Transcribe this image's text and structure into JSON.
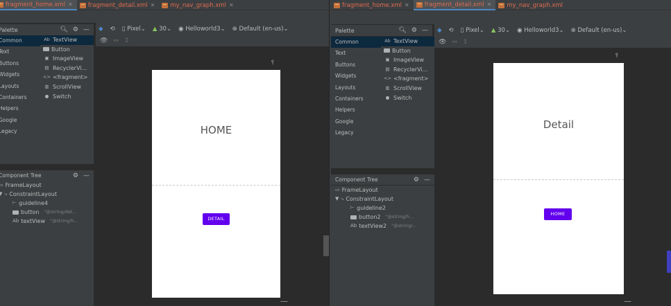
{
  "left": {
    "tabs": [
      {
        "label": "fragment_home.xml",
        "active": true
      },
      {
        "label": "fragment_detail.xml",
        "active": false
      },
      {
        "label": "my_nav_graph.xml",
        "active": false
      }
    ],
    "toolbar": {
      "device": "Pixel",
      "api": "30",
      "theme": "Helloworld3",
      "locale": "Default (en-us)"
    },
    "palette_title": "Palette",
    "categories": [
      "Common",
      "Text",
      "Buttons",
      "Widgets",
      "Layouts",
      "Containers",
      "Helpers",
      "Google",
      "Legacy"
    ],
    "items": [
      {
        "icon": "Ab",
        "label": "TextView"
      },
      {
        "icon": "",
        "label": "Button"
      },
      {
        "icon": "▣",
        "label": "ImageView"
      },
      {
        "icon": "▤",
        "label": "RecyclerVi..."
      },
      {
        "icon": "<>",
        "label": "<fragment>"
      },
      {
        "icon": "▥",
        "label": "ScrollView"
      },
      {
        "icon": "●",
        "label": "Switch"
      }
    ],
    "component_tree_title": "Component Tree",
    "tree": [
      {
        "icon": "▭",
        "label": "FrameLayout",
        "attr": ""
      },
      {
        "icon": "⤷",
        "label": "ConstraintLayout",
        "attr": ""
      },
      {
        "icon": "⊢",
        "label": "guideline4",
        "attr": ""
      },
      {
        "icon": "",
        "label": "button",
        "attr": "\"@string/det..."
      },
      {
        "icon": "Ab",
        "label": "textView",
        "attr": "\"@string/h..."
      }
    ],
    "design_title": "HOME",
    "design_button": "DETAIL"
  },
  "right": {
    "tabs": [
      {
        "label": "fragment_home.xml",
        "active": false
      },
      {
        "label": "fragment_detail.xml",
        "active": true
      },
      {
        "label": "my_nav_graph.xml",
        "active": false
      }
    ],
    "toolbar": {
      "device": "Pixel",
      "api": "30",
      "theme": "Helloworld3",
      "locale": "Default (en-us)"
    },
    "palette_title": "Palette",
    "categories": [
      "Common",
      "Text",
      "Buttons",
      "Widgets",
      "Layouts",
      "Containers",
      "Helpers",
      "Google",
      "Legacy"
    ],
    "items": [
      {
        "icon": "Ab",
        "label": "TextView"
      },
      {
        "icon": "",
        "label": "Button"
      },
      {
        "icon": "▣",
        "label": "ImageView"
      },
      {
        "icon": "▤",
        "label": "RecyclerVi..."
      },
      {
        "icon": "<>",
        "label": "<fragment>"
      },
      {
        "icon": "▥",
        "label": "ScrollView"
      },
      {
        "icon": "●",
        "label": "Switch"
      }
    ],
    "component_tree_title": "Component Tree",
    "tree": [
      {
        "icon": "▭",
        "label": "FrameLayout",
        "attr": ""
      },
      {
        "icon": "⤷",
        "label": "ConstraintLayout",
        "attr": ""
      },
      {
        "icon": "⊢",
        "label": "guideline2",
        "attr": ""
      },
      {
        "icon": "",
        "label": "button2",
        "attr": "\"@string/h..."
      },
      {
        "icon": "Ab",
        "label": "textView2",
        "attr": "\"@string/..."
      }
    ],
    "design_title": "Detail",
    "design_button": "HOME"
  },
  "colors": {
    "accent_button": "#6200ee",
    "tab_text": "#e06c4f",
    "tab_underline": "#4a88c7",
    "panel_bg": "#3c3f41",
    "canvas_bg": "#2b2b2b"
  }
}
